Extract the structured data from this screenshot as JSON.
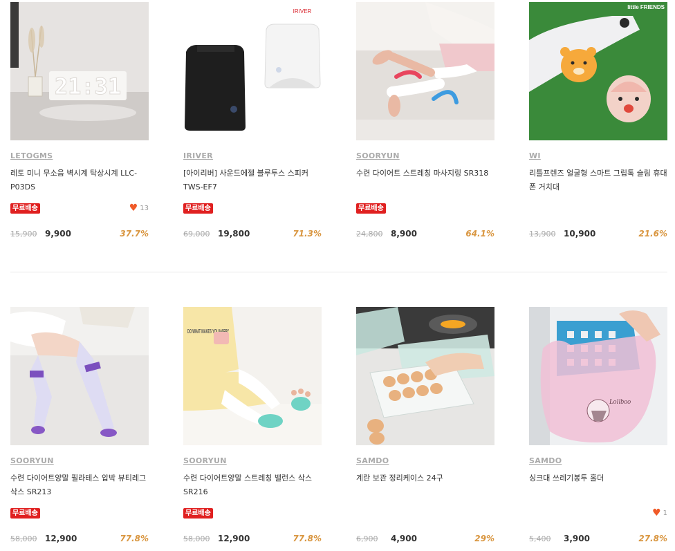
{
  "products": [
    {
      "brand": "LETOGMS",
      "name": "레토 미니 무소음 벽시계 탁상시계 LLC-P03DS",
      "badge": "무료배송",
      "likes": "13",
      "orig": "15,900",
      "sale": "9,900",
      "disc": "37.7%"
    },
    {
      "brand": "IRIVER",
      "name": "[아이리버] 사운드에젤 블루투스 스피커 TWS-EF7",
      "badge": "무료배송",
      "likes": "",
      "orig": "69,000",
      "sale": "19,800",
      "disc": "71.3%"
    },
    {
      "brand": "SOORYUN",
      "name": "수련 다이어트 스트레칭 마사지링 SR318",
      "badge": "무료배송",
      "likes": "",
      "orig": "24,800",
      "sale": "8,900",
      "disc": "64.1%"
    },
    {
      "brand": "WI",
      "name": "리틀프렌즈 얼굴형 스마트 그립톡 슬림 휴대폰 거치대",
      "badge": "",
      "likes": "",
      "orig": "13,900",
      "sale": "10,900",
      "disc": "21.6%"
    },
    {
      "brand": "SOORYUN",
      "name": "수련 다이어트양말 필라테스 압박 뷰티레그 삭스 SR213",
      "badge": "무료배송",
      "likes": "",
      "orig": "58,000",
      "sale": "12,900",
      "disc": "77.8%"
    },
    {
      "brand": "SOORYUN",
      "name": "수련 다이어트양말 스트레칭 밸런스 삭스 SR216",
      "badge": "무료배송",
      "likes": "",
      "orig": "58,000",
      "sale": "12,900",
      "disc": "77.8%"
    },
    {
      "brand": "SAMDO",
      "name": "계란 보관 정리케이스 24구",
      "badge": "",
      "likes": "",
      "orig": "6,900",
      "sale": "4,900",
      "disc": "29%"
    },
    {
      "brand": "SAMDO",
      "name": "싱크대 쓰레기봉투 홀더",
      "badge": "",
      "likes": "1",
      "orig": "5,400",
      "sale": "3,900",
      "disc": "27.8%"
    }
  ],
  "image_text": {
    "clock": "21:31",
    "iriver_logo": "IRIVER",
    "little_friends": "little FRIENDS",
    "shirt_text": "DO WHAT MAKES YOU HAPPY",
    "bag_text": "Lollboo"
  },
  "colors": {
    "badge": "#e02020",
    "discount": "#d99640",
    "heart": "#f05a28"
  }
}
